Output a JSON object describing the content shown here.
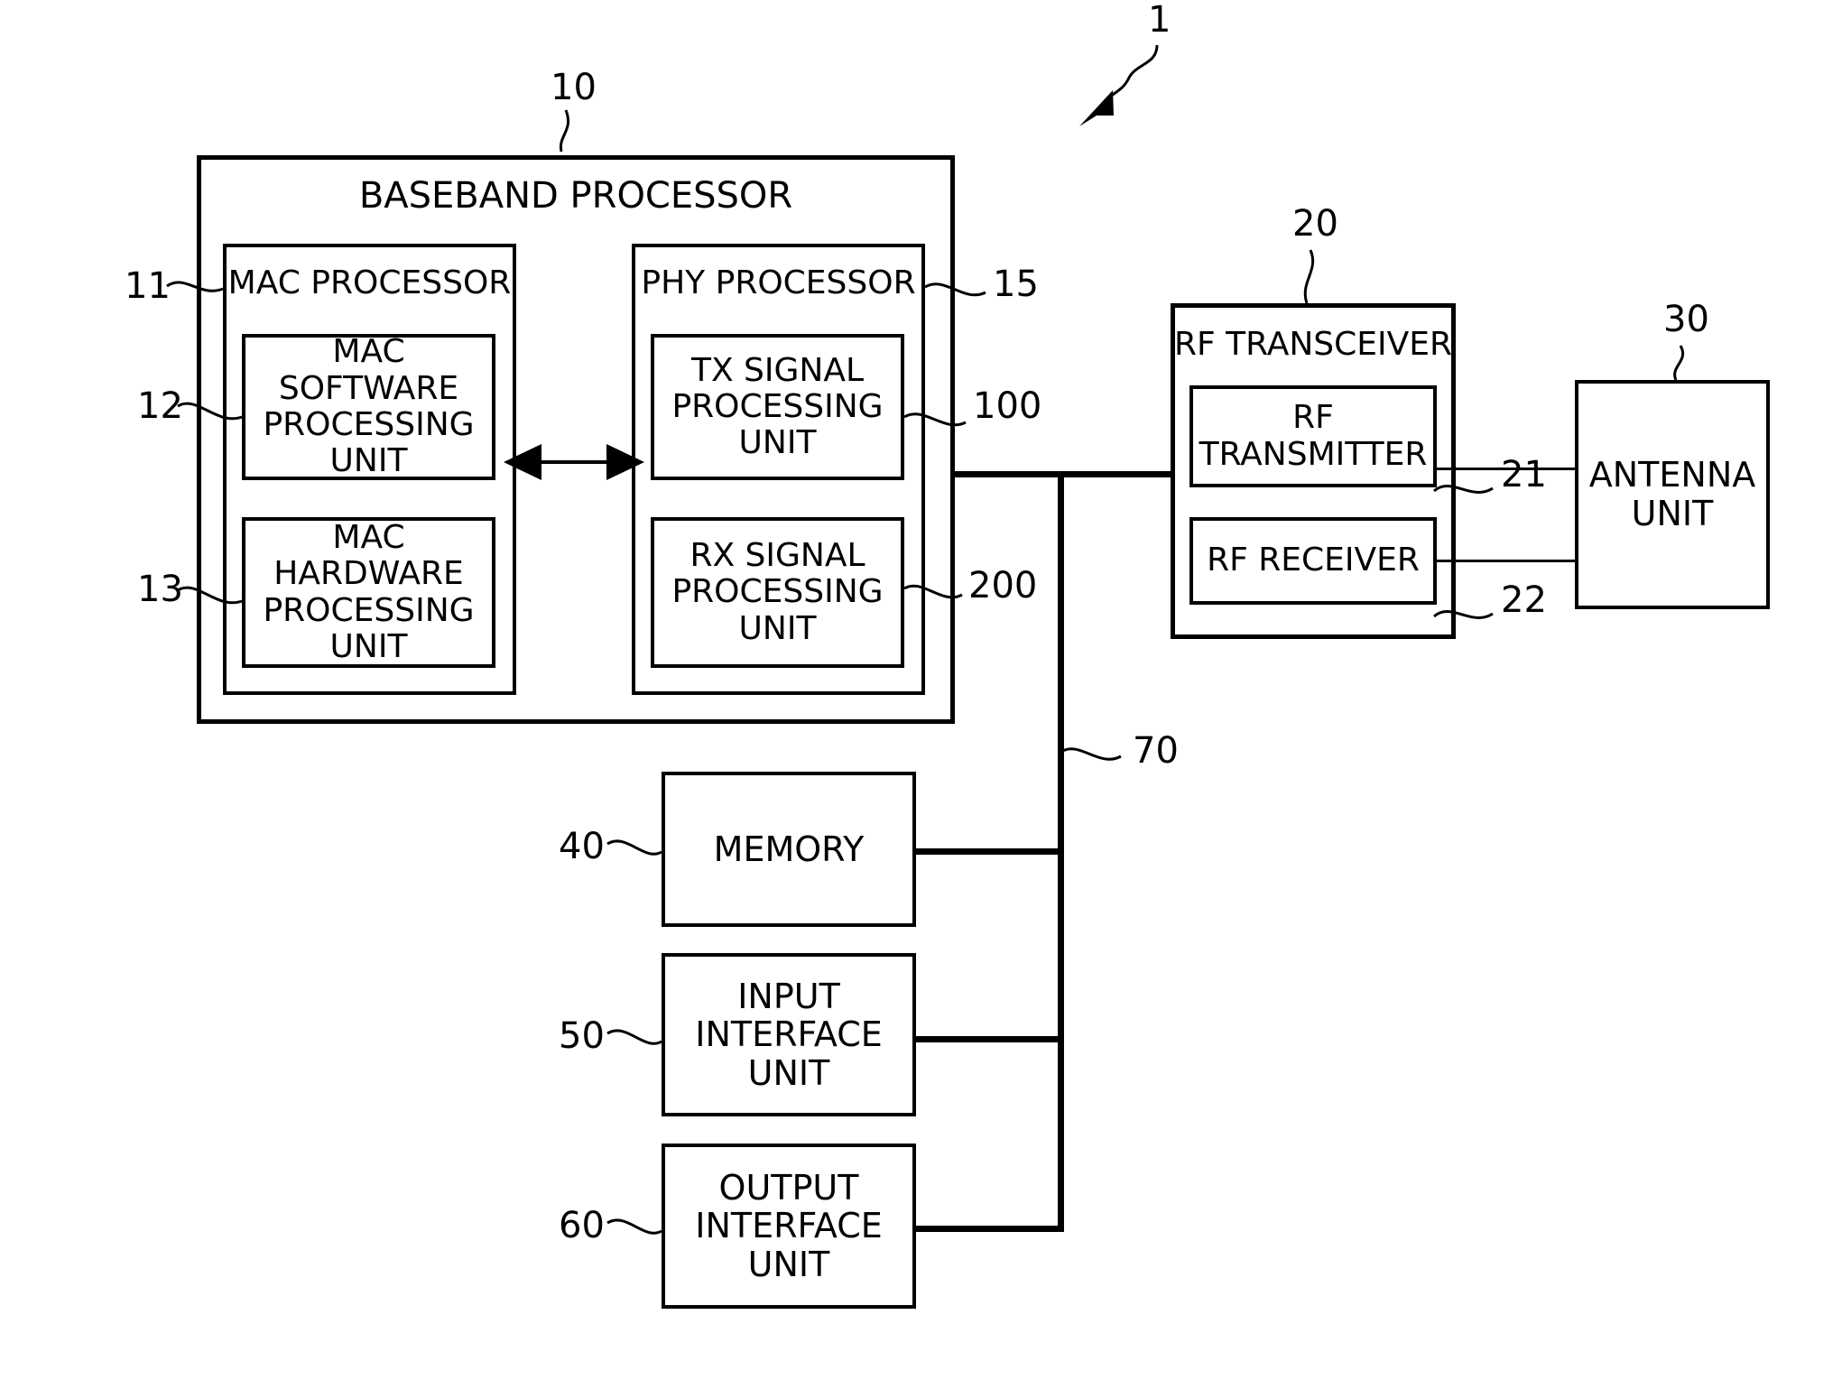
{
  "figure": {
    "system_ref": "1",
    "baseband_processor": {
      "title": "BASEBAND PROCESSOR",
      "ref": "10",
      "mac_processor": {
        "title": "MAC PROCESSOR",
        "ref": "11",
        "software_unit": {
          "label": "MAC\nSOFTWARE\nPROCESSING\nUNIT",
          "ref": "12"
        },
        "hardware_unit": {
          "label": "MAC\nHARDWARE\nPROCESSING\nUNIT",
          "ref": "13"
        }
      },
      "phy_processor": {
        "title": "PHY PROCESSOR",
        "ref": "15",
        "tx_unit": {
          "label": "TX SIGNAL\nPROCESSING\nUNIT",
          "ref": "100"
        },
        "rx_unit": {
          "label": "RX SIGNAL\nPROCESSING\nUNIT",
          "ref": "200"
        }
      }
    },
    "rf_transceiver": {
      "title": "RF TRANSCEIVER",
      "ref": "20",
      "transmitter": {
        "label": "RF\nTRANSMITTER",
        "ref": "21"
      },
      "receiver": {
        "label": "RF RECEIVER",
        "ref": "22"
      }
    },
    "antenna_unit": {
      "label": "ANTENNA\nUNIT",
      "ref": "30"
    },
    "memory": {
      "label": "MEMORY",
      "ref": "40"
    },
    "input_interface": {
      "label": "INPUT\nINTERFACE\nUNIT",
      "ref": "50"
    },
    "output_interface": {
      "label": "OUTPUT\nINTERFACE\nUNIT",
      "ref": "60"
    },
    "bus": {
      "ref": "70"
    }
  }
}
